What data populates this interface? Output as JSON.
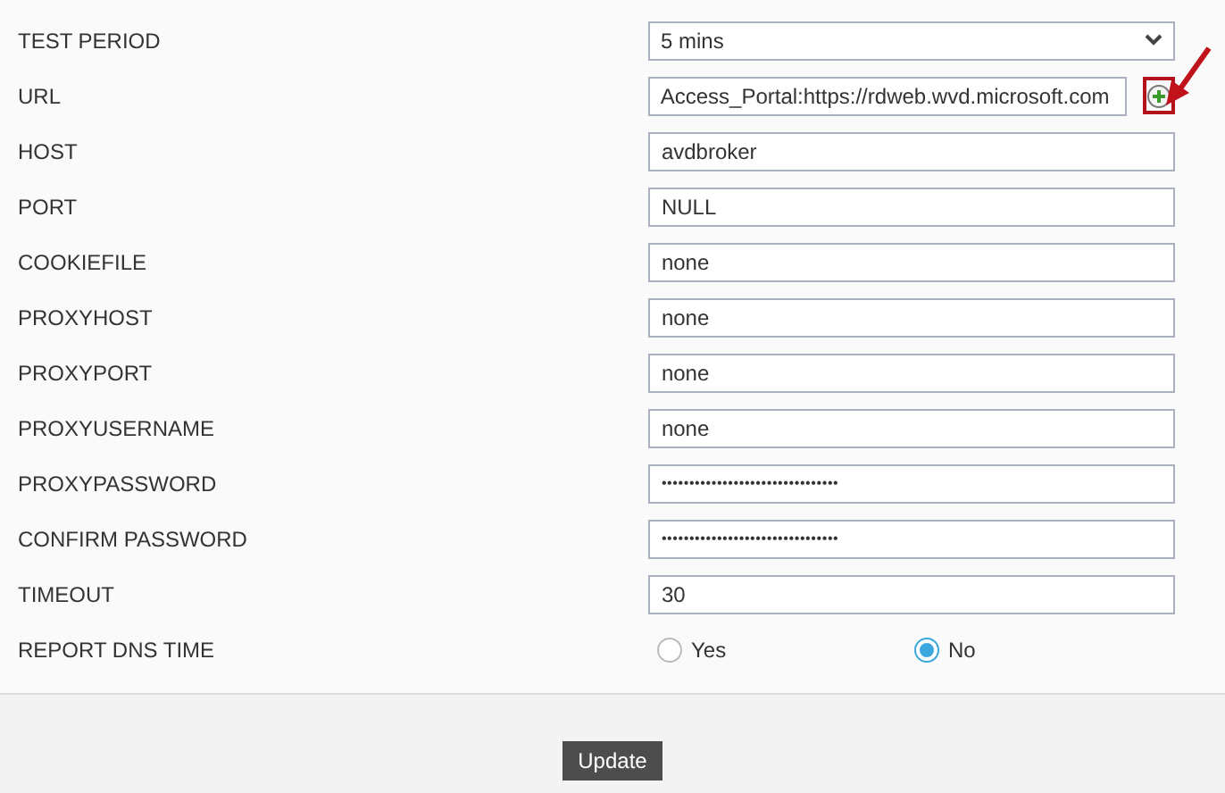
{
  "fields": [
    {
      "label": "TEST PERIOD",
      "kind": "select",
      "value": "5 mins"
    },
    {
      "label": "URL",
      "kind": "text-add",
      "value": "Access_Portal:https://rdweb.wvd.microsoft.com"
    },
    {
      "label": "HOST",
      "kind": "text",
      "value": "avdbroker"
    },
    {
      "label": "PORT",
      "kind": "text",
      "value": "NULL"
    },
    {
      "label": "COOKIEFILE",
      "kind": "text",
      "value": "none"
    },
    {
      "label": "PROXYHOST",
      "kind": "text",
      "value": "none"
    },
    {
      "label": "PROXYPORT",
      "kind": "text",
      "value": "none"
    },
    {
      "label": "PROXYUSERNAME",
      "kind": "text",
      "value": "none"
    },
    {
      "label": "PROXYPASSWORD",
      "kind": "text",
      "value": "••••••••••••••••••••••••••••••••"
    },
    {
      "label": "CONFIRM PASSWORD",
      "kind": "text",
      "value": "••••••••••••••••••••••••••••••••"
    },
    {
      "label": "TIMEOUT",
      "kind": "text",
      "value": "30"
    },
    {
      "label": "REPORT DNS TIME",
      "kind": "radio",
      "options": [
        {
          "label": "Yes",
          "selected": false
        },
        {
          "label": "No",
          "selected": true
        }
      ]
    }
  ],
  "update_button": "Update"
}
